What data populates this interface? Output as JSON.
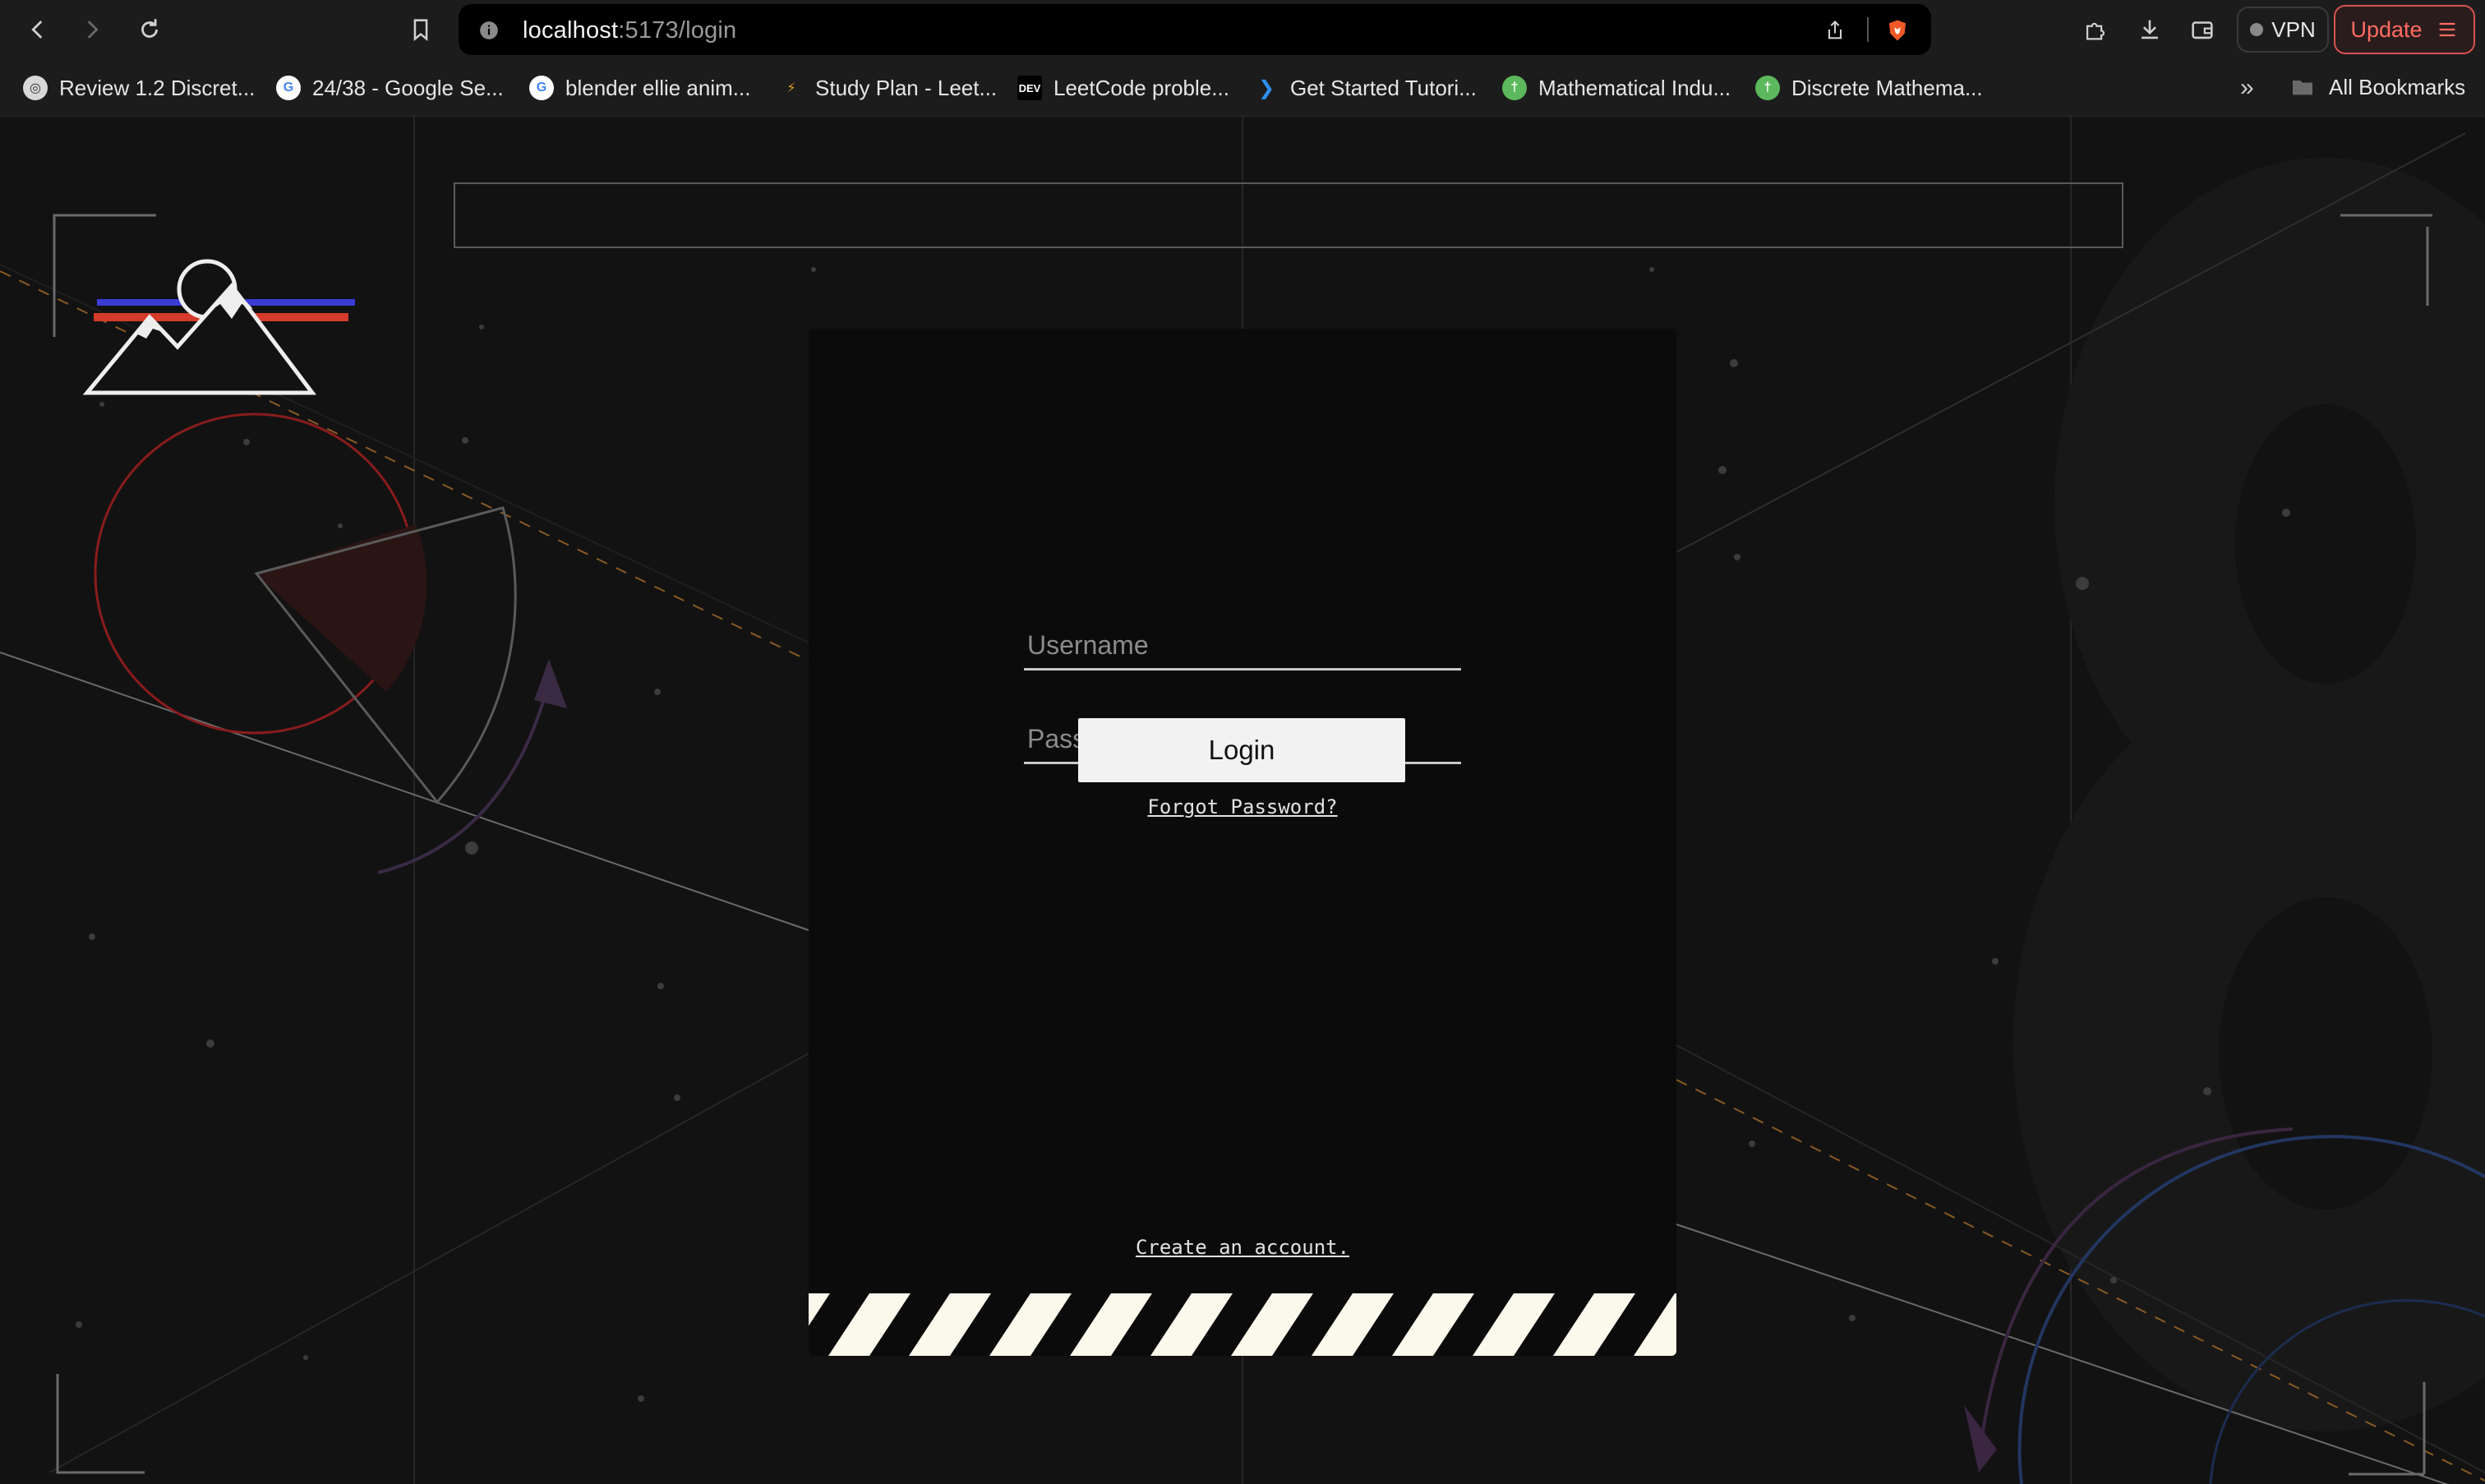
{
  "browser": {
    "url_host": "localhost",
    "url_path": ":5173/login",
    "vpn_label": "VPN",
    "update_label": "Update",
    "bookmarks": [
      {
        "label": "Review 1.2 Discret...",
        "icon": "globe-icon"
      },
      {
        "label": "24/38 - Google Se...",
        "icon": "google-icon"
      },
      {
        "label": "blender ellie anim...",
        "icon": "google-icon"
      },
      {
        "label": "Study Plan - Leet...",
        "icon": "leetcode-icon"
      },
      {
        "label": "LeetCode proble...",
        "icon": "dev-icon"
      },
      {
        "label": "Get Started Tutori...",
        "icon": "vscode-icon"
      },
      {
        "label": "Mathematical Indu...",
        "icon": "site-icon"
      },
      {
        "label": "Discrete Mathema...",
        "icon": "site-icon"
      }
    ],
    "bookmarks_overflow": "»",
    "all_bookmarks_label": "All Bookmarks"
  },
  "login": {
    "username_placeholder": "Username",
    "password_placeholder": "Password",
    "login_button": "Login",
    "forgot_password": "Forgot Password?",
    "create_account": "Create an account."
  },
  "colors": {
    "background": "#121212",
    "card": "#0b0b0b",
    "accent_red": "#d63a2a",
    "accent_blue": "#3b3bd6",
    "stripe_light": "#fbf8ec"
  }
}
